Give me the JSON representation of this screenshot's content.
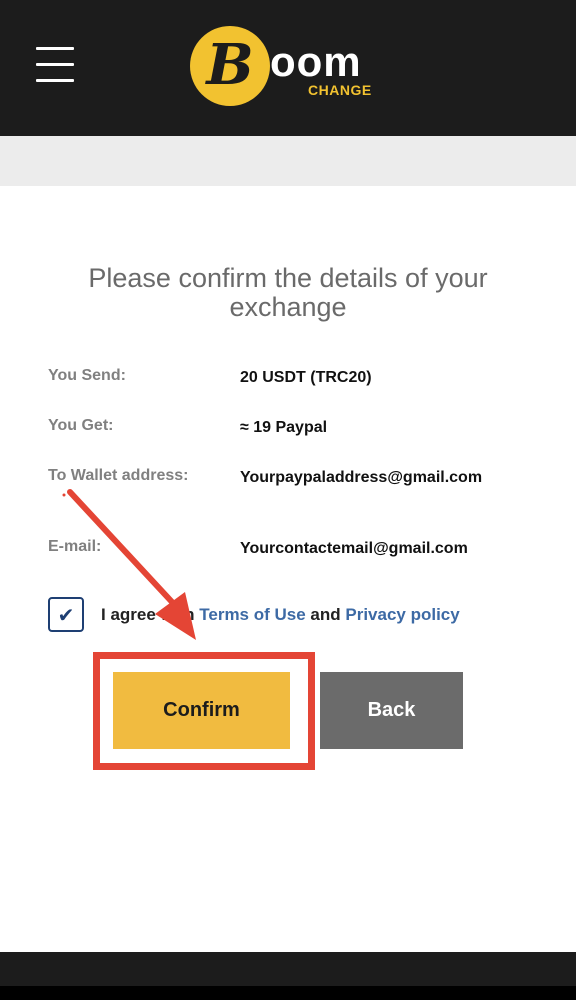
{
  "header": {
    "menu_icon": "hamburger-menu-icon",
    "logo": {
      "coin_glyph": "B",
      "word": "oom",
      "sub": "CHANGE"
    }
  },
  "confirm": {
    "title": "Please confirm the details of your exchange",
    "rows": [
      {
        "label": "You Send:",
        "value": "20 USDT (TRC20)"
      },
      {
        "label": "You Get:",
        "value": "≈ 19 Paypal"
      },
      {
        "label": "To Wallet address:",
        "value": "Yourpaypaladdress@gmail.com"
      },
      {
        "label": "E-mail:",
        "value": "Yourcontactemail@gmail.com"
      }
    ],
    "agree": {
      "checked": true,
      "check_glyph": "✔",
      "prefix": "I agree with ",
      "terms_link": "Terms of Use",
      "middle": " and ",
      "privacy_link": "Privacy policy"
    },
    "buttons": {
      "confirm": "Confirm",
      "back": "Back"
    }
  },
  "colors": {
    "header_bg": "#1c1c1c",
    "accent_yellow": "#f1bb40",
    "back_gray": "#6b6b6b",
    "link_blue": "#3d6aa5",
    "annotation_red": "#e44535"
  }
}
